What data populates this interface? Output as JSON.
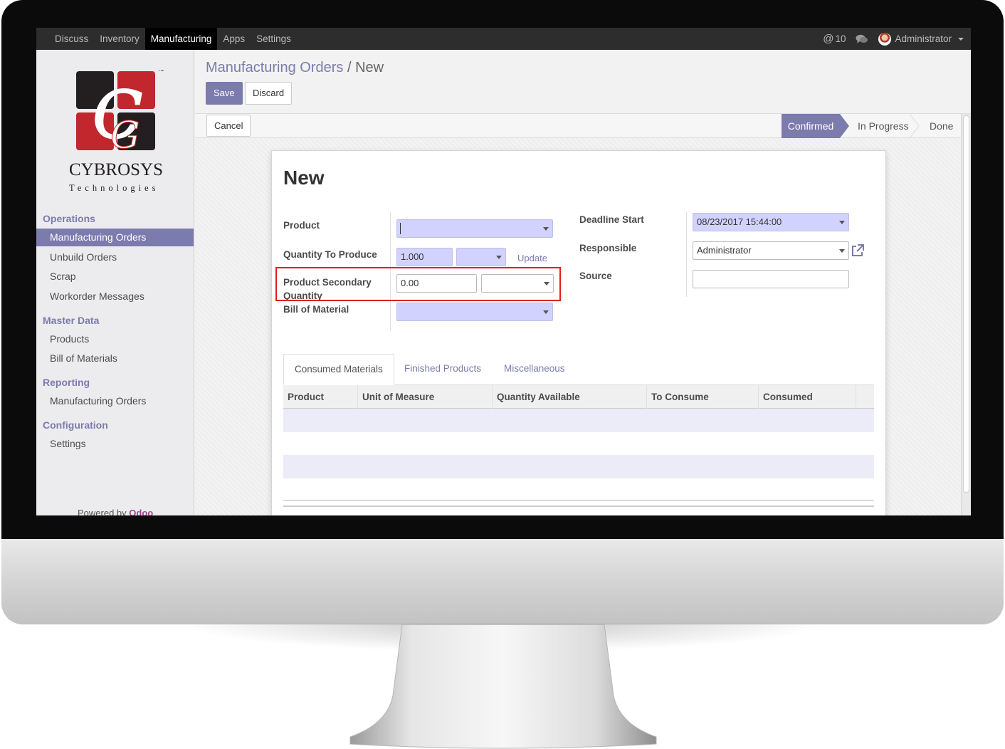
{
  "topbar": {
    "menu": [
      "Discuss",
      "Inventory",
      "Manufacturing",
      "Apps",
      "Settings"
    ],
    "active_menu": "Manufacturing",
    "mention_count": "10",
    "user": "Administrator"
  },
  "logo": {
    "brand": "CYBROSYS",
    "subtitle": "Technologies",
    "tm": "TM"
  },
  "sidebar": {
    "operations_title": "Operations",
    "operations": [
      "Manufacturing Orders",
      "Unbuild Orders",
      "Scrap",
      "Workorder Messages"
    ],
    "master_title": "Master Data",
    "master": [
      "Products",
      "Bill of Materials"
    ],
    "reporting_title": "Reporting",
    "reporting": [
      "Manufacturing Orders"
    ],
    "config_title": "Configuration",
    "config": [
      "Settings"
    ],
    "powered_by": "Powered by",
    "powered_brand": "Odoo"
  },
  "control": {
    "breadcrumb_parent": "Manufacturing Orders",
    "breadcrumb_sep": "/",
    "breadcrumb_current": "New",
    "save": "Save",
    "discard": "Discard",
    "cancel": "Cancel"
  },
  "status": {
    "stages": [
      "Confirmed",
      "In Progress",
      "Done"
    ],
    "active": "Confirmed"
  },
  "form": {
    "title": "New",
    "labels": {
      "product": "Product",
      "qty_to_produce": "Quantity To Produce",
      "secondary_qty_line1": "Product Secondary",
      "secondary_qty_line2": "Quantity",
      "bom": "Bill of Material",
      "deadline": "Deadline Start",
      "responsible": "Responsible",
      "source": "Source"
    },
    "values": {
      "product": "",
      "qty_to_produce": "1.000",
      "qty_uom": "",
      "secondary_qty": "0.00",
      "secondary_uom": "",
      "bom": "",
      "deadline": "08/23/2017 15:44:00",
      "responsible": "Administrator",
      "source": ""
    },
    "update_link": "Update"
  },
  "tabs": [
    "Consumed Materials",
    "Finished Products",
    "Miscellaneous"
  ],
  "table": {
    "columns": [
      "Product",
      "Unit of Measure",
      "Quantity Available",
      "To Consume",
      "Consumed"
    ]
  },
  "colors": {
    "accent": "#7c7bad",
    "required_field": "#d2d2ff",
    "highlight_box": "#e02020"
  }
}
